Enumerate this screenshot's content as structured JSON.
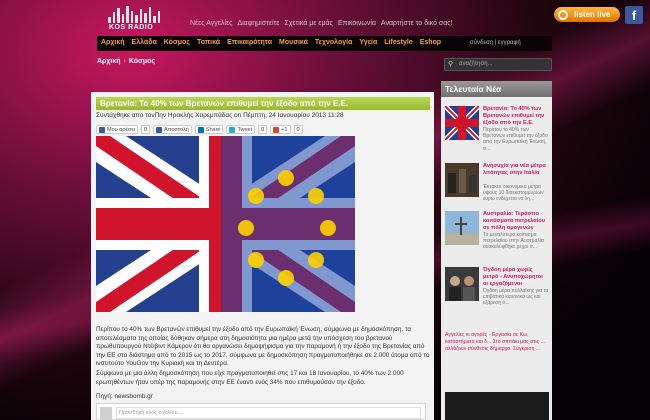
{
  "header": {
    "logo_text": "KOS RADIO",
    "top_links": [
      "Νέες Αγγελίες",
      "Διαφημιστείτε",
      "Σχετικά με εμάς",
      "Επικοινωνία",
      "Αναρτήστε το δικό σας!"
    ],
    "listen_live": "listen live",
    "facebook_letter": "f"
  },
  "nav": {
    "items": [
      "Αρχική",
      "Ελλάδα",
      "Κόσμος",
      "Τοπικά",
      "Επικαιρότητα",
      "Μουσικά",
      "Τεχνολογία",
      "Υγεία",
      "Lifestyle",
      "Eshop"
    ],
    "login": "σύνδεση | εγγραφή"
  },
  "breadcrumb": {
    "home": "Αρχική",
    "sep": "›",
    "current": "Κόσμος"
  },
  "search": {
    "placeholder": "αναζήτηση..."
  },
  "article": {
    "title": "Βρετανία: Το 40% των Βρετανών επιθυμεί την έξοδο από την Ε.Ε.",
    "byline": "Συντάχθηκε απο τονΠην Ηρακλής Χαρεμπάδας on Πέμπτη, 24 Ιανουαρίου 2013 11:28",
    "share": {
      "like": "Μου αρέσει",
      "like_count": "0",
      "send": "Αποστολή",
      "share": "Share",
      "tweet": "Tweet",
      "tweet_count": "0",
      "plus": "+1",
      "plus_count": "0"
    },
    "body_p1": "Περίπου το 40% των Βρετανών επιθυμεί την έξοδο από την Ευρωπαϊκή Ένωση, σύμφωνα με δημοσκόπηση, τα αποτελέσματα της οποίας δόθηκαν σήμερα στη δημοσιότητα μια ημέρα μετά την υπόσχεση του βρετανού πρωθυπουργού Ντέιβιντ Κάμερον ότι θα οργανώσει δημοψήφισμα για την παραμονή ή την έξοδο της Βρετανίας από την ΕΕ στο διάστημα από το 2015 ως το 2017, σύμφωνα με δημοσκόπηση πραγματοποιήθηκε σε 2.000 άτομα από το ινστιτούτο YouGov την Κυριακή και τη Δευτέρα.",
    "body_p2": "Σύμφωνα με μια άλλη δημοσκόπηση που είχε πραγματοποιηθεί στις 17 και 18 Ιανουαρίου, το 40% των 2.000 ερωτηθέντων ήταν υπέρ της παραμονής στην ΕΕ έναντι ενός 34% που επιθυμούσαν την έξοδο.",
    "source": "Πηγή: newsbomb.gr",
    "comment_placeholder": "Προσθήκη ενός σχολίου..."
  },
  "sidebar": {
    "title": "Τελευταία Νέα",
    "news": [
      {
        "title": "Βρετανία: Το 40% των Βρετανών επιθυμεί την έξοδο από την Ε.Ε.",
        "snippet": "Περίπου το 40% των Βρετανών επιθυμεί την έξοδο από την Ευρωπαϊκή Ένωση, σ..."
      },
      {
        "title": "Ανησυχία για νέα μέτρα λιτότητας στην Ιταλία",
        "snippet": "Έκτακτα οικονομικά μέτρα ύψους 10 δισεκατομμυρίων ευρώ ενδέχεται να λη..."
      },
      {
        "title": "Αυστραλία: Τεράστιο κοιτάσματα πετρελαίου σε πόλη ομογενών",
        "snippet": "Το μεγαλύτερο κοίτασμα πετρελαίου στην Αυστραλία ανακαλύφθηκε μέχρι σ..."
      },
      {
        "title": "Όγδοη μέρα χωρίς μετρό - Ανυποχώρητοι οι εργαζόμενοι",
        "snippet": "Όγδοη μέρα παλλαϊκής για τα επιβατικά κανονικά ως και εξάρεση ο..."
      }
    ],
    "footer": "Αγγελίες κι αγορές - Εργασία σε Κω, καταστήματα και δ...  Στο σπιτάκι μας στις ...  αλλάζουν σύνθεσις  δήμαρχο. Σύγκριση ..."
  },
  "colors": {
    "nav_orange": "#f2a23a",
    "title_green": "#a4c83e",
    "accent_pink": "#d2145a"
  }
}
